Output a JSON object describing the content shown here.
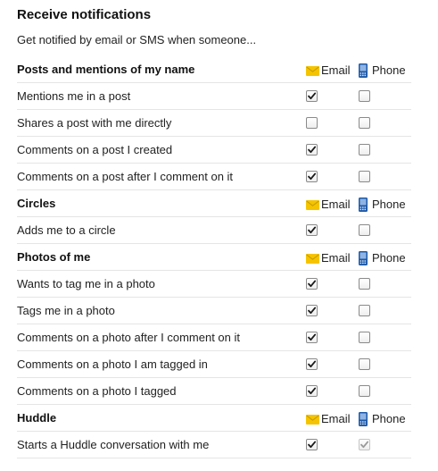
{
  "heading": {
    "title": "Receive notifications",
    "subtitle": "Get notified by email or SMS when someone..."
  },
  "column_labels": {
    "email": "Email",
    "phone": "Phone"
  },
  "colors": {
    "envelope": "#f5c400",
    "phone_icon": "#1e5aa8",
    "check_mark": "#1a1a1a",
    "check_mark_disabled": "#9a9a9a"
  },
  "sections": [
    {
      "title": "Posts and mentions of my name",
      "items": [
        {
          "label": "Mentions me in a post",
          "email": true,
          "phone": false
        },
        {
          "label": "Shares a post with me directly",
          "email": false,
          "phone": false
        },
        {
          "label": "Comments on a post I created",
          "email": true,
          "phone": false
        },
        {
          "label": "Comments on a post after I comment on it",
          "email": true,
          "phone": false
        }
      ]
    },
    {
      "title": "Circles",
      "items": [
        {
          "label": "Adds me to a circle",
          "email": true,
          "phone": false
        }
      ]
    },
    {
      "title": "Photos of me",
      "items": [
        {
          "label": "Wants to tag me in a photo",
          "email": true,
          "phone": false
        },
        {
          "label": "Tags me in a photo",
          "email": true,
          "phone": false
        },
        {
          "label": "Comments on a photo after I comment on it",
          "email": true,
          "phone": false
        },
        {
          "label": "Comments on a photo I am tagged in",
          "email": true,
          "phone": false
        },
        {
          "label": "Comments on a photo I tagged",
          "email": true,
          "phone": false
        }
      ]
    },
    {
      "title": "Huddle",
      "items": [
        {
          "label": "Starts a Huddle conversation with me",
          "email": true,
          "phone": true,
          "phone_disabled": true
        }
      ]
    }
  ]
}
